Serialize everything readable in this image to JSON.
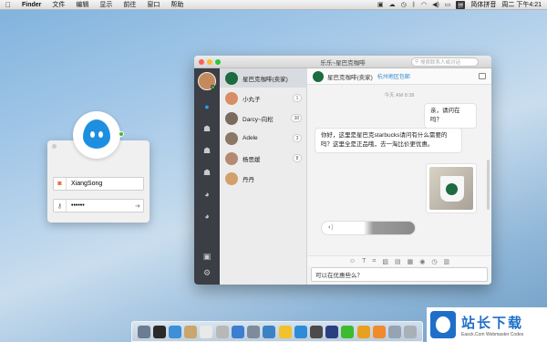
{
  "menubar": {
    "app": "Finder",
    "items": [
      "文件",
      "编辑",
      "显示",
      "前往",
      "窗口",
      "帮助"
    ],
    "input_method": "简体拼音",
    "clock": "周二 下午4:21"
  },
  "login": {
    "username": "XiangSong",
    "password": "••••••"
  },
  "window": {
    "title": "乐乐~星巴克咖啡",
    "search_placeholder": "搜索联系人或对话"
  },
  "contacts": [
    {
      "name": "星巴克咖啡(卖家)",
      "count": "",
      "color": "#1d6b3f"
    },
    {
      "name": "小丸子",
      "count": "1",
      "color": "#d98d64"
    },
    {
      "name": "Darcy~向松",
      "count": "38",
      "color": "#7b6a5e"
    },
    {
      "name": "Adele",
      "count": "3",
      "color": "#8a7766"
    },
    {
      "name": "杨思媛",
      "count": "8",
      "color": "#b58a72"
    },
    {
      "name": "丹丹",
      "count": "",
      "color": "#d2a06b"
    }
  ],
  "conversation": {
    "header_name": "星巴克咖啡(卖家)",
    "header_location": "杭州地区包邮",
    "timestamp": "今天 AM 8:38",
    "messages": [
      {
        "text": "亲，请问在吗？"
      },
      {
        "text": "你好，这里是星巴克starbucks请问有什么需要的吗？这里全是正品哦，去一淘比价更优惠。"
      }
    ],
    "input_text": "可以在优惠些么？"
  },
  "watermark": {
    "title": "站长下载",
    "url": "Easck.Com Webmaster Codes"
  }
}
